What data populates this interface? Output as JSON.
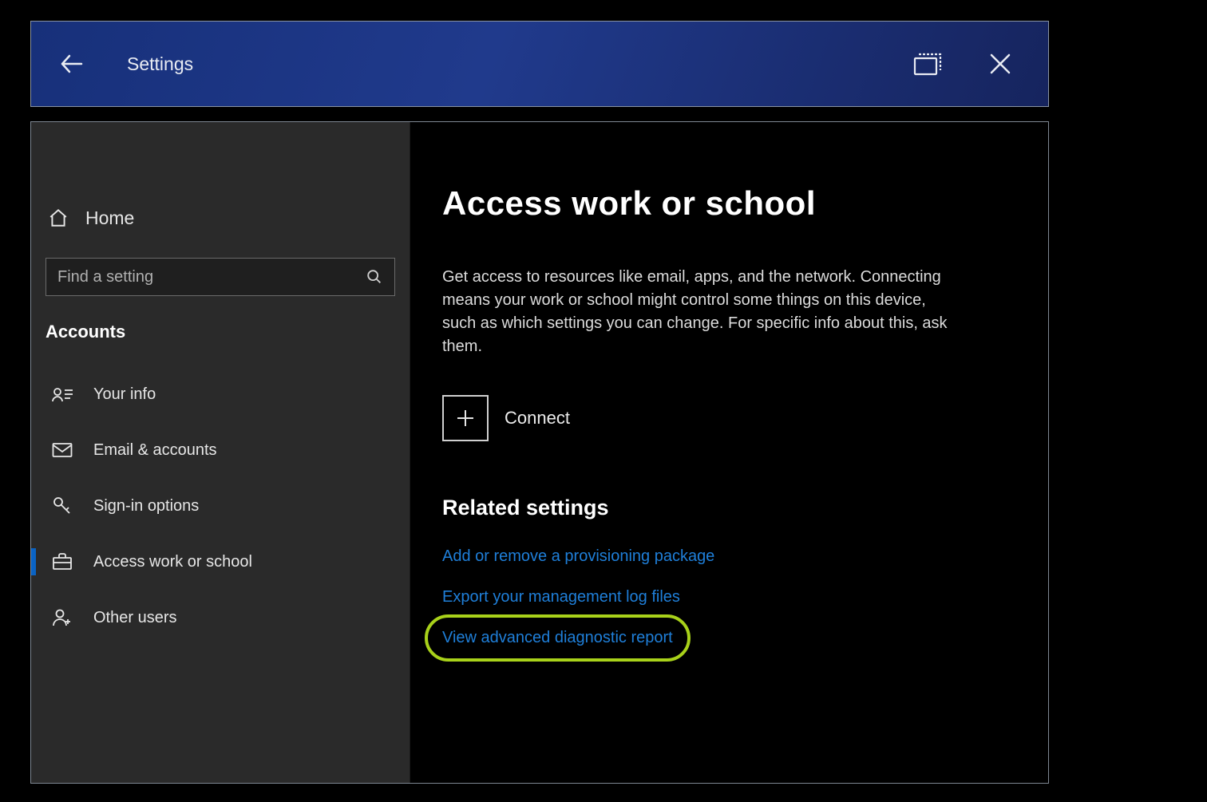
{
  "titlebar": {
    "title": "Settings"
  },
  "sidebar": {
    "home_label": "Home",
    "search_placeholder": "Find a setting",
    "section_label": "Accounts",
    "items": [
      {
        "label": "Your info"
      },
      {
        "label": "Email & accounts"
      },
      {
        "label": "Sign-in options"
      },
      {
        "label": "Access work or school"
      },
      {
        "label": "Other users"
      }
    ],
    "active_index": 3
  },
  "content": {
    "heading": "Access work or school",
    "description": "Get access to resources like email, apps, and the network. Connecting means your work or school might control some things on this device, such as which settings you can change. For specific info about this, ask them.",
    "connect_label": "Connect",
    "related_heading": "Related settings",
    "links": [
      {
        "label": "Add or remove a provisioning package"
      },
      {
        "label": "Export your management log files"
      },
      {
        "label": "View advanced diagnostic report"
      }
    ],
    "highlighted_link_index": 2
  },
  "colors": {
    "accent": "#0a63c4",
    "link": "#1f7fd9",
    "highlight": "#a8d11a"
  }
}
